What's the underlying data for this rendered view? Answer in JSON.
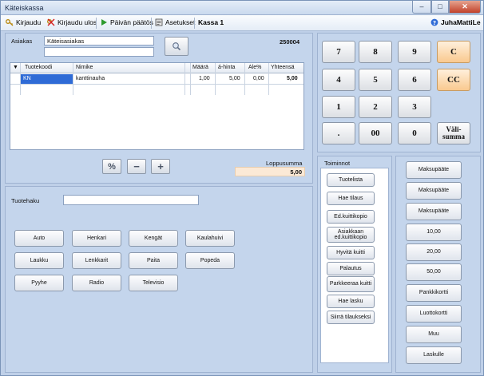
{
  "window": {
    "title": "Käteiskassa",
    "min": "–",
    "max": "□",
    "close": "✕"
  },
  "toolbar": {
    "login": "Kirjaudu",
    "logout": "Kirjaudu ulos",
    "day_close": "Päivän päätös",
    "settings": "Asetukset",
    "register": "Kassa 1",
    "user": "JuhaMattiLe"
  },
  "customer": {
    "label": "Asiakas",
    "value": "Käteisasiakas",
    "second_value": "",
    "number": "250004"
  },
  "grid": {
    "headers": [
      "Tuotekoodi",
      "Nimike",
      "Määrä",
      "á-hinta",
      "Ale%",
      "Yhteensä"
    ],
    "rows": [
      {
        "code": "KN",
        "name": "kanttinauha",
        "qty": "1,00",
        "price": "5,00",
        "discount": "0,00",
        "total": "5,00"
      }
    ]
  },
  "total": {
    "label": "Loppusumma",
    "value": "5,00"
  },
  "line_buttons": {
    "percent": "%",
    "minus": "−",
    "plus": "+"
  },
  "search": {
    "label": "Tuotehaku",
    "value": ""
  },
  "products": [
    "Auto",
    "Henkari",
    "Kengät",
    "Kaulahuivi",
    "Laukku",
    "Lenkkarit",
    "Paita",
    "Popeda",
    "Pyyhe",
    "Radio",
    "Televisio"
  ],
  "keypad": {
    "k7": "7",
    "k8": "8",
    "k9": "9",
    "c": "C",
    "k4": "4",
    "k5": "5",
    "k6": "6",
    "cc": "CC",
    "k1": "1",
    "k2": "2",
    "k3": "3",
    "dot": ".",
    "k00": "00",
    "k0": "0",
    "subtotal_1": "Väli-",
    "subtotal_2": "summa"
  },
  "functions": {
    "title": "Toiminnot",
    "items": [
      "Tuotelista",
      "Hae tilaus",
      "Ed.kuittikopio",
      "Asiakkaan ed.kuittikopio",
      "Hyvitä kuitti",
      "Palautus",
      "Parkkeeraa kuitti",
      "Hae lasku",
      "Siirrä tilaukseksi"
    ]
  },
  "payments": [
    "Maksupääte",
    "Maksupääte",
    "Maksupääte",
    "10,00",
    "20,00",
    "50,00",
    "Pankkikortti",
    "Luottokortti",
    "Muu",
    "Laskulle"
  ],
  "colors": {
    "accent_orange": "#f9c98f",
    "selection_blue": "#2f6bd6",
    "panel": "#c4d5ec"
  }
}
